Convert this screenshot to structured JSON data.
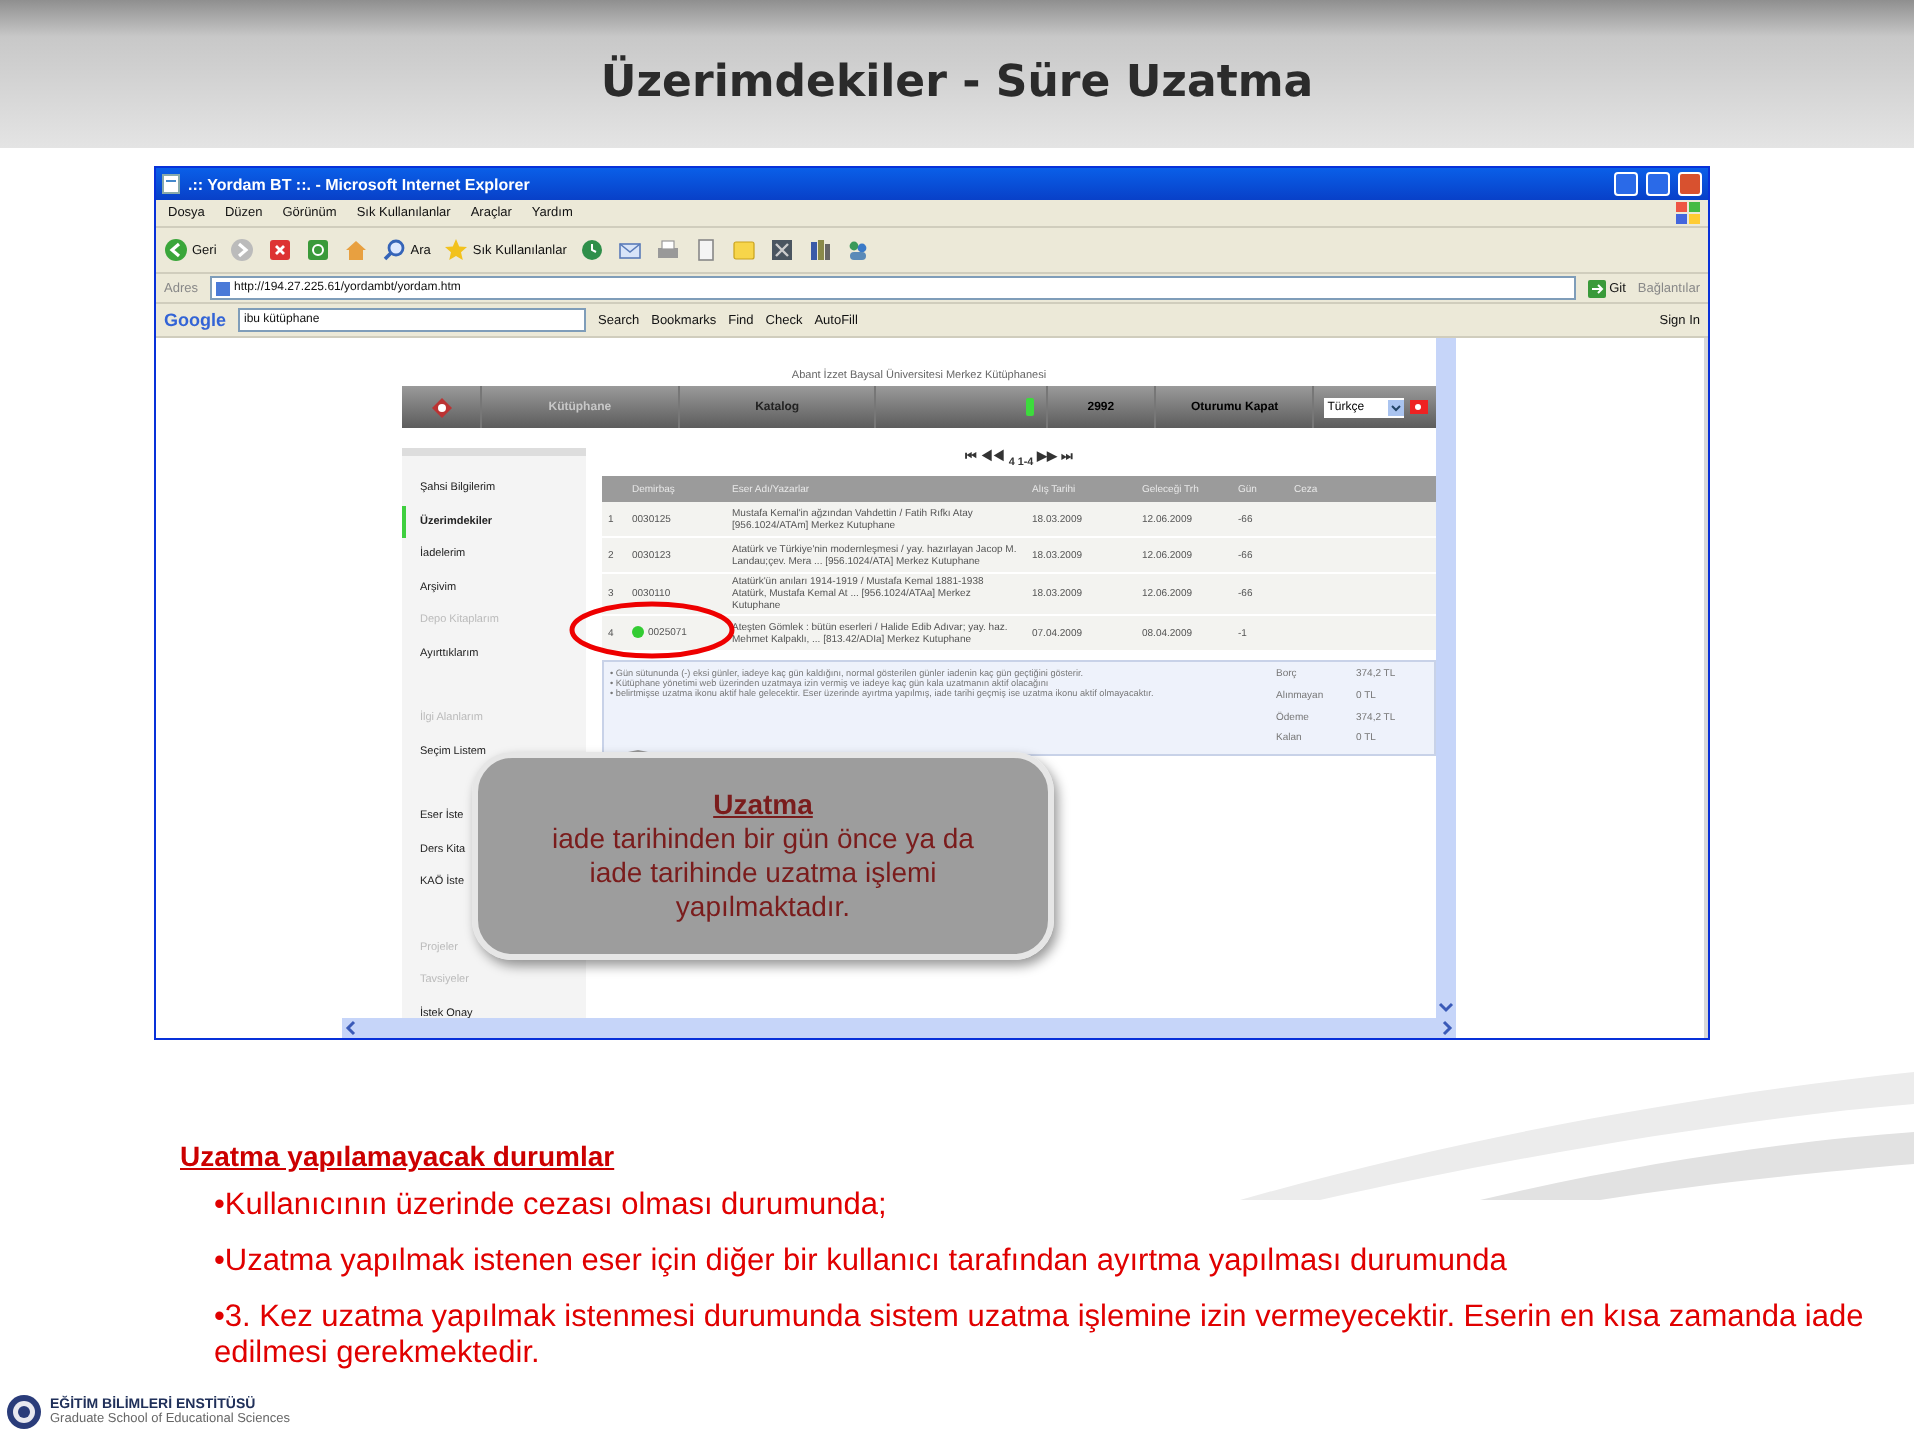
{
  "slide_title": "Üzerimdekiler - Süre Uzatma",
  "browser": {
    "title": ".:: Yordam BT ::. - Microsoft Internet Explorer",
    "menu": [
      "Dosya",
      "Düzen",
      "Görünüm",
      "Sık Kullanılanlar",
      "Araçlar",
      "Yardım"
    ],
    "toolbar": [
      {
        "kind": "back",
        "label": "Geri"
      },
      {
        "kind": "forward"
      },
      {
        "kind": "stop"
      },
      {
        "kind": "refresh"
      },
      {
        "kind": "home"
      },
      {
        "kind": "search",
        "label": "Ara"
      },
      {
        "kind": "favorites",
        "label": "Sık Kullanılanlar"
      },
      {
        "kind": "history"
      },
      {
        "kind": "mail"
      },
      {
        "kind": "print"
      },
      {
        "kind": "edit"
      },
      {
        "kind": "folder"
      },
      {
        "kind": "app"
      },
      {
        "kind": "books"
      },
      {
        "kind": "messenger"
      }
    ],
    "address": {
      "label": "Adres",
      "value": "http://194.27.225.61/yordambt/yordam.htm",
      "go": "Git",
      "links": "Bağlantılar"
    },
    "google_bar": {
      "logo": "Google",
      "query": "ibu kütüphane",
      "items": [
        "Search",
        "Bookmarks",
        "Find",
        "Check",
        "AutoFill"
      ],
      "sign_in": "Sign In"
    }
  },
  "library": {
    "header": "Abant İzzet Baysal Üniversitesi Merkez Kütüphanesi",
    "nav": [
      {
        "label": "Kütüphane",
        "disabled": true
      },
      {
        "label": "Katalog",
        "disabled": false
      }
    ],
    "user_id": "2992",
    "logout": "Oturumu Kapat",
    "language": "Türkçe",
    "sidebar": [
      [
        {
          "label": "Şahsi Bilgilerim",
          "selected": false,
          "disabled": false
        },
        {
          "label": "Üzerimdekiler",
          "selected": true,
          "disabled": false
        },
        {
          "label": "İadelerim",
          "selected": false,
          "disabled": false
        },
        {
          "label": "Arşivim",
          "selected": false,
          "disabled": false
        },
        {
          "label": "Depo Kitaplarım",
          "selected": false,
          "disabled": true
        },
        {
          "label": "Ayırttıklarım",
          "selected": false,
          "disabled": false
        }
      ],
      [
        {
          "label": "İlgi Alanlarım",
          "selected": false,
          "disabled": true
        },
        {
          "label": "Seçim Listem",
          "selected": false,
          "disabled": false
        }
      ],
      [
        {
          "label": "Eser İste",
          "selected": false,
          "disabled": false
        },
        {
          "label": "Ders Kita",
          "selected": false,
          "disabled": false
        },
        {
          "label": "KAÖ İste",
          "selected": false,
          "disabled": false
        }
      ],
      [
        {
          "label": "Projeler",
          "selected": false,
          "disabled": true
        },
        {
          "label": "Tavsiyeler",
          "selected": false,
          "disabled": true
        },
        {
          "label": "İstek Onay",
          "selected": false,
          "disabled": false
        }
      ]
    ],
    "pager": {
      "first": "⏮",
      "prev": "◀◀",
      "range": "4 1-4",
      "next": "▶▶",
      "last": "⏭"
    },
    "columns": [
      "Demirbaş",
      "Eser Adı/Yazarlar",
      "Alış Tarihi",
      "Geleceği Trh",
      "Gün",
      "Ceza"
    ],
    "rows": [
      {
        "no": "1",
        "barcode": "0030125",
        "title": "Mustafa Kemal'in ağzından Vahdettin / Fatih Rıfkı Atay [956.1024/ATAm] Merkez Kutuphane",
        "taken": "18.03.2009",
        "due": "12.06.2009",
        "days": "-66",
        "renewable": false
      },
      {
        "no": "2",
        "barcode": "0030123",
        "title": "Atatürk ve Türkiye'nin modernleşmesi / yay. hazırlayan Jacop M. Landau;çev. Mera ... [956.1024/ATA] Merkez Kutuphane",
        "taken": "18.03.2009",
        "due": "12.06.2009",
        "days": "-66",
        "renewable": false
      },
      {
        "no": "3",
        "barcode": "0030110",
        "title": "Atatürk'ün anıları 1914-1919 / Mustafa Kemal 1881-1938 Atatürk, Mustafa Kemal At ... [956.1024/ATAa] Merkez Kutuphane",
        "taken": "18.03.2009",
        "due": "12.06.2009",
        "days": "-66",
        "renewable": false
      },
      {
        "no": "4",
        "barcode": "0025071",
        "title": "Ateşten Gömlek : bütün eserleri / Halide Edib Adıvar; yay. haz. Mehmet Kalpaklı, ... [813.42/ADIa] Merkez Kutuphane",
        "taken": "07.04.2009",
        "due": "08.04.2009",
        "days": "-1",
        "renewable": true
      }
    ],
    "info": [
      "• Gün sütununda (-) eksi günler, iadeye kaç gün kaldığını, normal gösterilen günler iadenin kaç gün geçtiğini gösterir.",
      "• Kütüphane yönetimi web üzerinden uzatmaya izin vermiş ve iadeye kaç gün kala uzatmanın aktif olacağını",
      "• belirtmişse uzatma ikonu aktif hale gelecektir. Eser üzerinde ayırtma yapılmış, iade tarihi geçmiş ise uzatma ikonu aktif olmayacaktır."
    ],
    "summary": [
      {
        "label": "Borç",
        "value": "374,2 TL"
      },
      {
        "label": "Alınmayan",
        "value": "0 TL"
      },
      {
        "label": "Ödeme",
        "value": "374,2 TL"
      },
      {
        "label": "Kalan",
        "value": "0 TL"
      }
    ]
  },
  "callout": {
    "title": "Uzatma",
    "lines": [
      "iade tarihinden bir gün önce ya da",
      "iade tarihinde uzatma işlemi",
      "yapılmaktadır."
    ]
  },
  "notes": {
    "heading": "Uzatma yapılamayacak durumlar",
    "bullets": [
      "•Kullanıcının üzerinde cezası olması durumunda;",
      "•Uzatma yapılmak istenen eser için diğer bir kullanıcı tarafından ayırtma yapılması durumunda",
      "•3. Kez uzatma yapılmak istenmesi durumunda sistem uzatma işlemine izin vermeyecektir. Eserin en kısa zamanda iade edilmesi gerekmektedir."
    ]
  },
  "footer": {
    "name": "EĞİTİM BİLİMLERİ ENSTİTÜSÜ",
    "subtitle": "Graduate School of Educational Sciences"
  }
}
